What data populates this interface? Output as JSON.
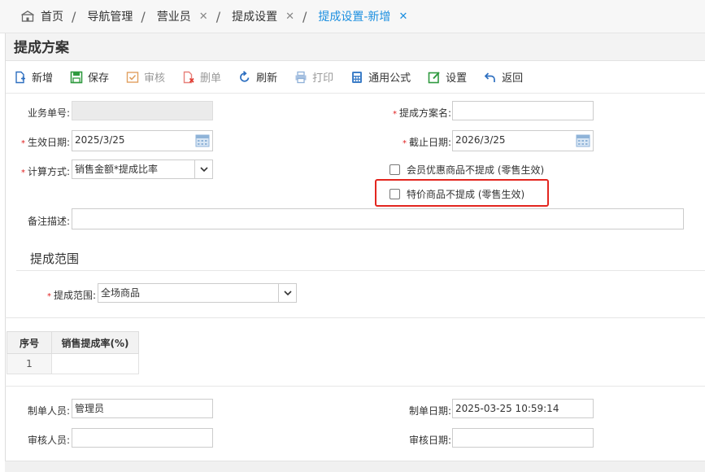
{
  "breadcrumb": {
    "home": "首页",
    "nav": "导航管理",
    "salesman": "营业员",
    "commission_settings": "提成设置",
    "active": "提成设置-新增"
  },
  "panel_title": "提成方案",
  "toolbar": {
    "new": "新增",
    "save": "保存",
    "audit": "审核",
    "delete": "删单",
    "refresh": "刷新",
    "print": "打印",
    "formula": "通用公式",
    "settings": "设置",
    "back": "返回"
  },
  "form": {
    "doc_no_label": "业务单号:",
    "doc_no_value": "",
    "plan_name_label": "提成方案名:",
    "plan_name_value": "",
    "start_date_label": "生效日期:",
    "start_date_value": "2025/3/25",
    "end_date_label": "截止日期:",
    "end_date_value": "2026/3/25",
    "calc_method_label": "计算方式:",
    "calc_method_value": "销售金额*提成比率",
    "member_discount_label": "会员优惠商品不提成 (零售生效)",
    "special_price_label": "特价商品不提成 (零售生效)",
    "remark_label": "备注描述:",
    "remark_value": ""
  },
  "scope": {
    "section_title": "提成范围",
    "scope_label": "提成范围:",
    "scope_value": "全场商品"
  },
  "grid": {
    "columns": [
      "序号",
      "销售提成率(%)"
    ],
    "rows": [
      [
        "1",
        ""
      ]
    ]
  },
  "footer": {
    "creator_label": "制单人员:",
    "creator_value": "管理员",
    "create_date_label": "制单日期:",
    "create_date_value": "2025-03-25 10:59:14",
    "auditor_label": "审核人员:",
    "auditor_value": "",
    "audit_date_label": "审核日期:",
    "audit_date_value": ""
  },
  "colors": {
    "accent": "#1c8fe0",
    "required": "#e02020",
    "highlight": "#e3261f"
  }
}
